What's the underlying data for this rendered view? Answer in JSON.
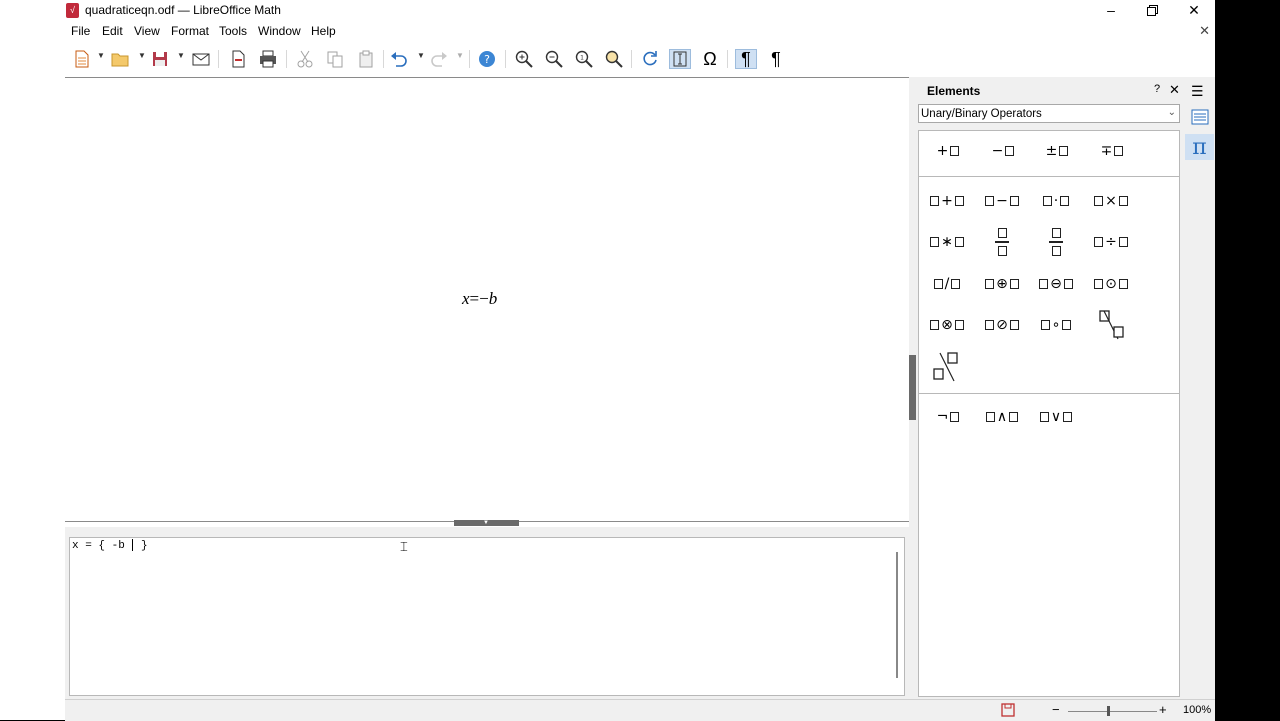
{
  "window": {
    "title": "quadraticeqn.odf — LibreOffice Math",
    "app_icon": "√",
    "controls": [
      "minimize",
      "maximize",
      "close"
    ]
  },
  "menubar": {
    "items": [
      "File",
      "Edit",
      "View",
      "Format",
      "Tools",
      "Window",
      "Help"
    ],
    "close_doc": "✕"
  },
  "toolbar": {
    "buttons": [
      "new",
      "open",
      "save",
      "email",
      "export-pdf",
      "print",
      "cut",
      "copy",
      "paste",
      "undo",
      "redo",
      "help",
      "zoom-in",
      "zoom-out",
      "zoom-100",
      "show-all",
      "update",
      "formula-cursor",
      "symbols",
      "formatting-marks",
      "formatting-marks-alt"
    ]
  },
  "formula": {
    "lhs": "x",
    "eq": "=",
    "rhs_op": "−",
    "rhs_var": "b"
  },
  "editor": {
    "text_before_caret": "x = { -b ",
    "text_after_caret": " }"
  },
  "sidebar": {
    "title": "Elements",
    "help": "?",
    "close": "✕",
    "category": "Unary/Binary Operators",
    "unary": [
      "+",
      "−",
      "±",
      "∓"
    ],
    "binary": [
      "+",
      "−",
      "·",
      "×",
      "∗",
      "÷",
      "/",
      "⊕",
      "⊖",
      "⊙",
      "⊗",
      "⊘",
      "∘"
    ],
    "logic_unary": "¬",
    "logic_binary": [
      "∧",
      "∨"
    ]
  },
  "status": {
    "zoom": "100%",
    "zoom_fraction": 0.45
  }
}
